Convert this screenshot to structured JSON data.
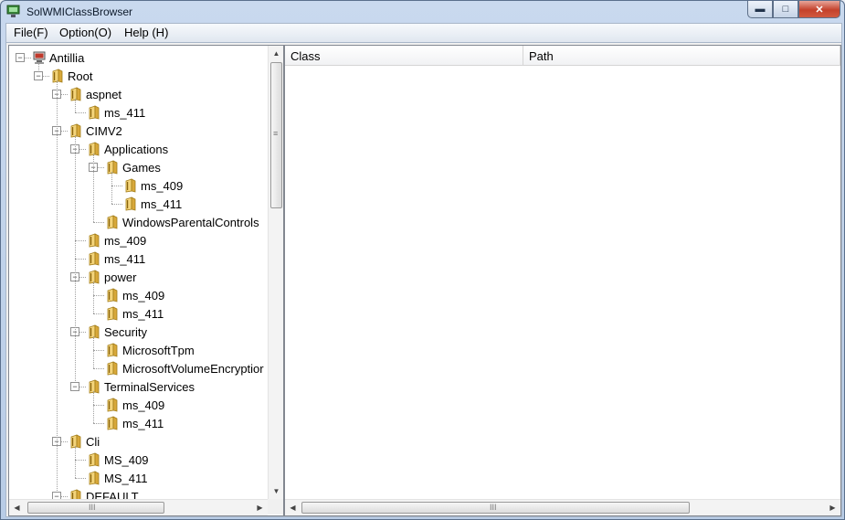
{
  "window": {
    "title": "SolWMIClassBrowser"
  },
  "caption_buttons": {
    "minimize": "▬",
    "maximize": "□",
    "close": "✕"
  },
  "menu": [
    {
      "label": "File(F)"
    },
    {
      "label": "Option(O)"
    },
    {
      "label": "Help (H)"
    }
  ],
  "tree": {
    "nodes": [
      {
        "label": "Antillia",
        "icon": "computer-icon"
      },
      {
        "label": "Root",
        "icon": "folder-icon"
      },
      {
        "label": "aspnet",
        "icon": "folder-icon"
      },
      {
        "label": "ms_411",
        "icon": "folder-icon"
      },
      {
        "label": "CIMV2",
        "icon": "folder-icon"
      },
      {
        "label": "Applications",
        "icon": "folder-icon"
      },
      {
        "label": "Games",
        "icon": "folder-icon"
      },
      {
        "label": "ms_409",
        "icon": "folder-icon"
      },
      {
        "label": "ms_411",
        "icon": "folder-icon"
      },
      {
        "label": "WindowsParentalControls",
        "icon": "folder-icon"
      },
      {
        "label": "ms_409",
        "icon": "folder-icon"
      },
      {
        "label": "ms_411",
        "icon": "folder-icon"
      },
      {
        "label": "power",
        "icon": "folder-icon"
      },
      {
        "label": "ms_409",
        "icon": "folder-icon"
      },
      {
        "label": "ms_411",
        "icon": "folder-icon"
      },
      {
        "label": "Security",
        "icon": "folder-icon"
      },
      {
        "label": "MicrosoftTpm",
        "icon": "folder-icon"
      },
      {
        "label": "MicrosoftVolumeEncryptior",
        "icon": "folder-icon"
      },
      {
        "label": "TerminalServices",
        "icon": "folder-icon"
      },
      {
        "label": "ms_409",
        "icon": "folder-icon"
      },
      {
        "label": "ms_411",
        "icon": "folder-icon"
      },
      {
        "label": "Cli",
        "icon": "folder-icon"
      },
      {
        "label": "MS_409",
        "icon": "folder-icon"
      },
      {
        "label": "MS_411",
        "icon": "folder-icon"
      },
      {
        "label": "DEFAULT",
        "icon": "folder-icon"
      }
    ]
  },
  "list": {
    "columns": [
      {
        "label": "Class"
      },
      {
        "label": "Path"
      }
    ]
  },
  "scroll_glyphs": {
    "grip_v": "≡",
    "grip_h": "III",
    "up": "▲",
    "down": "▼",
    "left": "◀",
    "right": "▶"
  },
  "colors": {
    "titlebar": "#c9d9ee",
    "close_button": "#c4412b",
    "folder": "#e0b64a"
  }
}
